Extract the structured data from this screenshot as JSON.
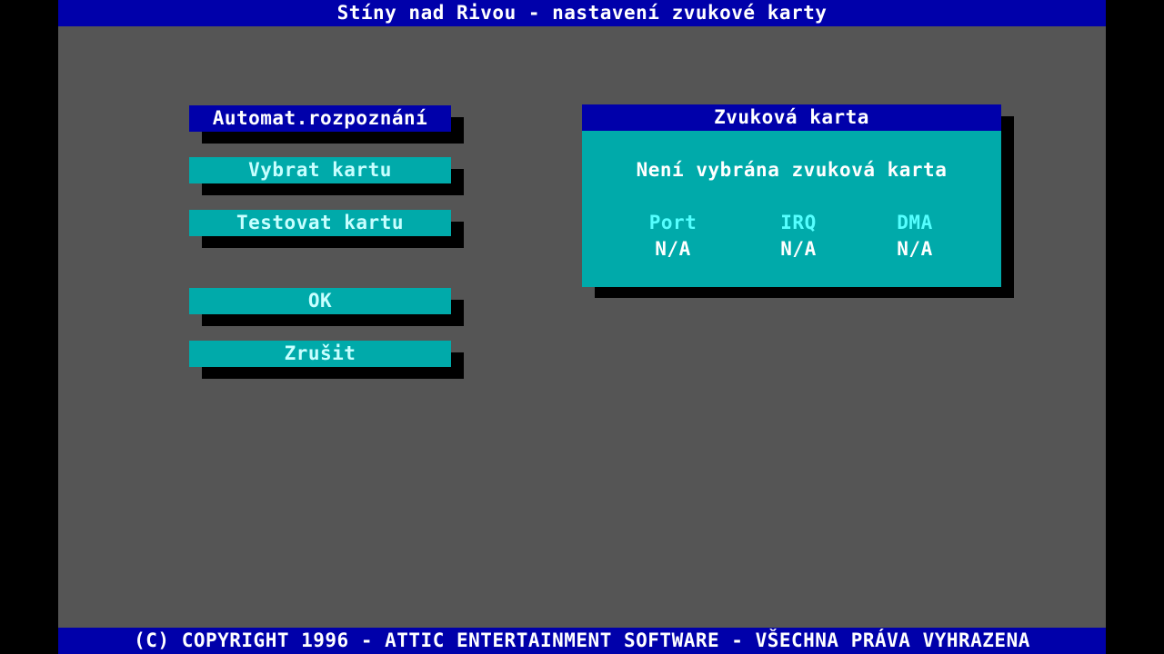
{
  "window": {
    "title": "Stíny nad Rivou - nastavení zvukové karty"
  },
  "menu": {
    "items": [
      {
        "label": "Automat.rozpoznání",
        "selected": true
      },
      {
        "label": "Vybrat kartu",
        "selected": false
      },
      {
        "label": "Testovat kartu",
        "selected": false
      },
      {
        "label": "OK",
        "selected": false
      },
      {
        "label": "Zrušit",
        "selected": false
      }
    ]
  },
  "sound_card": {
    "title": "Zvuková karta",
    "status": "Není vybrána zvuková karta",
    "columns": [
      {
        "label": "Port",
        "value": "N/A"
      },
      {
        "label": "IRQ",
        "value": "N/A"
      },
      {
        "label": "DMA",
        "value": "N/A"
      }
    ]
  },
  "footer": {
    "text": "(C) COPYRIGHT 1996 - ATTIC ENTERTAINMENT SOFTWARE - VŠECHNA PRÁVA VYHRAZENA"
  },
  "colors": {
    "background": "#555555",
    "title_bar": "#0000AA",
    "button": "#00AAAA",
    "selected_button": "#0000AA",
    "panel": "#00AAAA",
    "panel_header": "#0000AA",
    "column_label": "#55FFFF",
    "shadow": "#000000"
  }
}
